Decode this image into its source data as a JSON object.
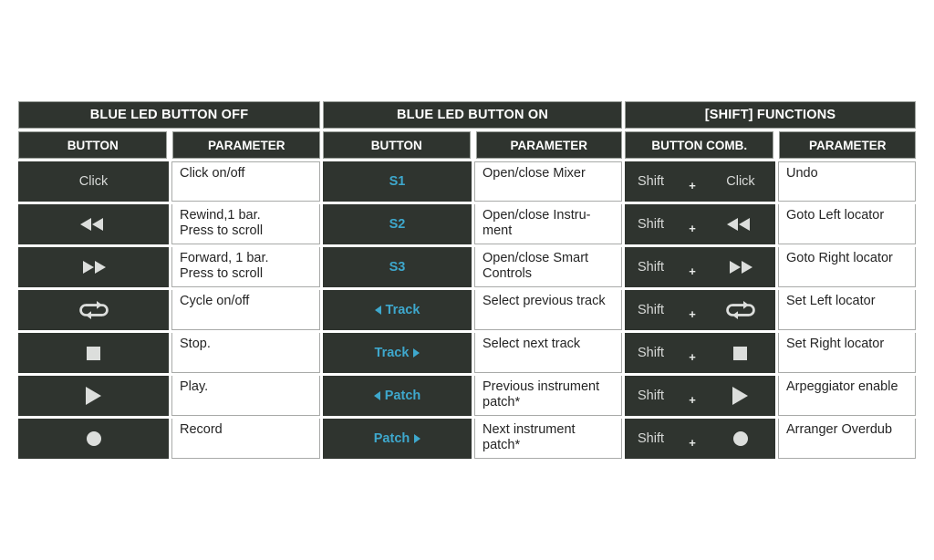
{
  "groups": [
    {
      "title": "BLUE LED BUTTON OFF",
      "col_button": "BUTTON",
      "col_parameter": "PARAMETER",
      "rows": [
        {
          "button_text": "Click",
          "button_icon": "",
          "button_style": "text",
          "parameter": "Click on/off"
        },
        {
          "button_text": "",
          "button_icon": "rewind-icon",
          "button_style": "icon",
          "parameter": "Rewind,1 bar.\nPress to scroll"
        },
        {
          "button_text": "",
          "button_icon": "forward-icon",
          "button_style": "icon",
          "parameter": "Forward, 1 bar.\nPress to scroll"
        },
        {
          "button_text": "",
          "button_icon": "cycle-icon",
          "button_style": "icon",
          "parameter": "Cycle on/off"
        },
        {
          "button_text": "",
          "button_icon": "stop-icon",
          "button_style": "icon",
          "parameter": "Stop."
        },
        {
          "button_text": "",
          "button_icon": "play-icon",
          "button_style": "icon",
          "parameter": "Play."
        },
        {
          "button_text": "",
          "button_icon": "record-icon",
          "button_style": "icon",
          "parameter": "Record"
        }
      ]
    },
    {
      "title": "BLUE LED BUTTON ON",
      "col_button": "BUTTON",
      "col_parameter": "PARAMETER",
      "rows": [
        {
          "button_text": "S1",
          "button_icon": "",
          "button_style": "blue-text",
          "parameter": "Open/close Mixer"
        },
        {
          "button_text": "S2",
          "button_icon": "",
          "button_style": "blue-text",
          "parameter": "Open/close Instru-\nment"
        },
        {
          "button_text": "S3",
          "button_icon": "",
          "button_style": "blue-text",
          "parameter": "Open/close Smart\nControls"
        },
        {
          "button_text": "Track",
          "button_icon": "caret-left-icon",
          "button_style": "blue-nav-left",
          "parameter": "Select previous track"
        },
        {
          "button_text": "Track",
          "button_icon": "caret-right-icon",
          "button_style": "blue-nav-right",
          "parameter": "Select next track"
        },
        {
          "button_text": "Patch",
          "button_icon": "caret-left-icon",
          "button_style": "blue-nav-left",
          "parameter": "Previous instrument\npatch*"
        },
        {
          "button_text": "Patch",
          "button_icon": "caret-right-icon",
          "button_style": "blue-nav-right",
          "parameter": "Next instrument\npatch*"
        }
      ]
    },
    {
      "title": "[SHIFT] FUNCTIONS",
      "col_button": "BUTTON COMB.",
      "col_parameter": "PARAMETER",
      "modifier": "Shift",
      "plus": "+",
      "rows": [
        {
          "button_text": "Click",
          "button_icon": "",
          "button_style": "text",
          "parameter": "Undo"
        },
        {
          "button_text": "",
          "button_icon": "rewind-icon",
          "button_style": "icon",
          "parameter": "Goto Left locator"
        },
        {
          "button_text": "",
          "button_icon": "forward-icon",
          "button_style": "icon",
          "parameter": "Goto Right locator"
        },
        {
          "button_text": "",
          "button_icon": "cycle-icon",
          "button_style": "icon",
          "parameter": "Set Left locator"
        },
        {
          "button_text": "",
          "button_icon": "stop-icon",
          "button_style": "icon",
          "parameter": "Set Right locator"
        },
        {
          "button_text": "",
          "button_icon": "play-icon",
          "button_style": "icon",
          "parameter": "Arpeggiator enable"
        },
        {
          "button_text": "",
          "button_icon": "record-icon",
          "button_style": "icon",
          "parameter": "Arranger Overdub"
        }
      ]
    }
  ],
  "colors": {
    "cell_dark": "#2f342f",
    "cell_light": "#ffffff",
    "accent_blue": "#3ea8cd",
    "grid_line": "#9a9f9a",
    "icon_fill": "#dcdedc"
  }
}
